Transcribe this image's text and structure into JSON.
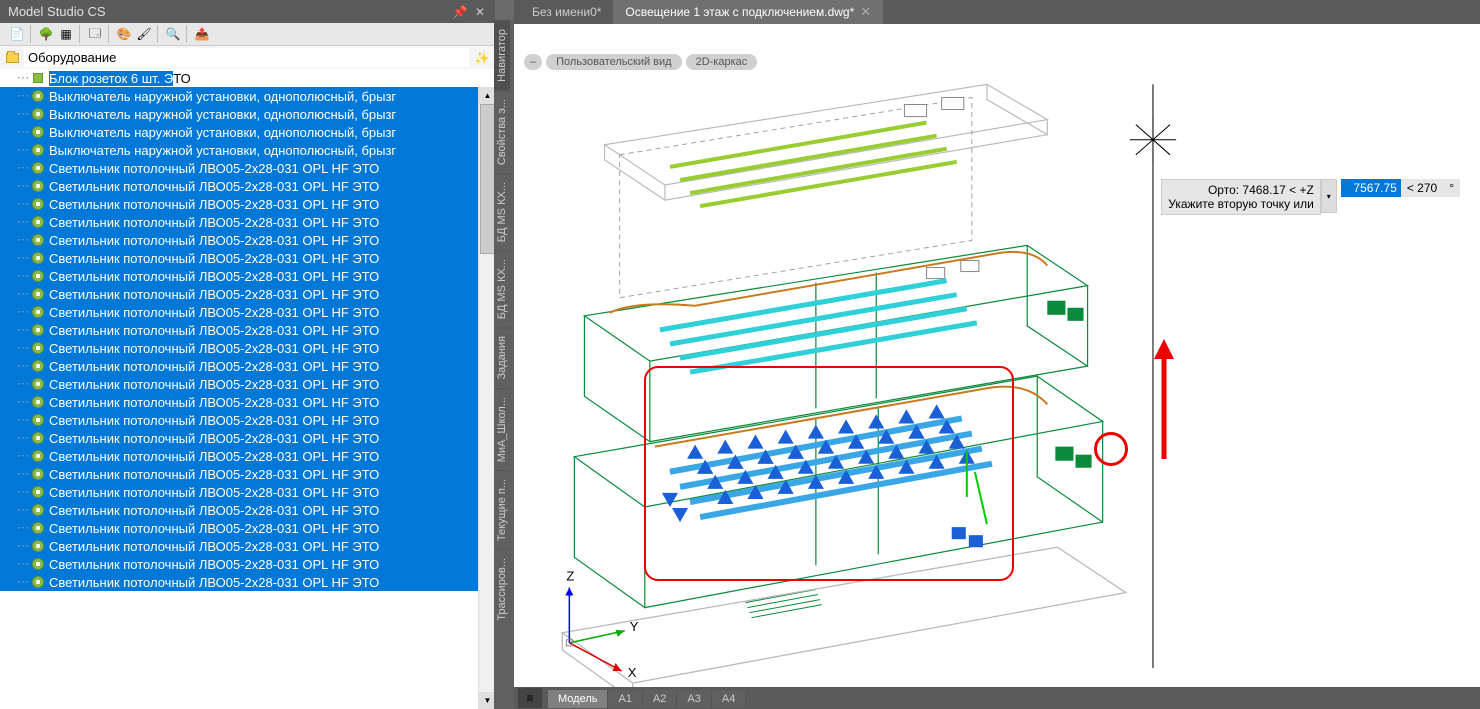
{
  "panel": {
    "title": "Model Studio CS",
    "search_label": "Оборудование",
    "tree": [
      {
        "type": "block",
        "label": "Блок розеток 6 шт.  ЭТО",
        "sel": "part"
      },
      {
        "type": "gear",
        "label": "Выключатель наружной установки, однополюсный, брызг",
        "sel": "full"
      },
      {
        "type": "gear",
        "label": "Выключатель наружной установки, однополюсный, брызг",
        "sel": "full"
      },
      {
        "type": "gear",
        "label": "Выключатель наружной установки, однополюсный, брызг",
        "sel": "full"
      },
      {
        "type": "gear",
        "label": "Выключатель наружной установки, однополюсный, брызг",
        "sel": "full"
      },
      {
        "type": "gear",
        "label": "Светильник потолочный ЛВО05-2х28-031 OPL HF  ЭТО",
        "sel": "full"
      },
      {
        "type": "gear",
        "label": "Светильник потолочный ЛВО05-2х28-031 OPL HF  ЭТО",
        "sel": "full"
      },
      {
        "type": "gear",
        "label": "Светильник потолочный ЛВО05-2х28-031 OPL HF  ЭТО",
        "sel": "full"
      },
      {
        "type": "gear",
        "label": "Светильник потолочный ЛВО05-2х28-031 OPL HF  ЭТО",
        "sel": "full"
      },
      {
        "type": "gear",
        "label": "Светильник потолочный ЛВО05-2х28-031 OPL HF  ЭТО",
        "sel": "full"
      },
      {
        "type": "gear",
        "label": "Светильник потолочный ЛВО05-2х28-031 OPL HF  ЭТО",
        "sel": "full"
      },
      {
        "type": "gear",
        "label": "Светильник потолочный ЛВО05-2х28-031 OPL HF  ЭТО",
        "sel": "full"
      },
      {
        "type": "gear",
        "label": "Светильник потолочный ЛВО05-2х28-031 OPL HF  ЭТО",
        "sel": "full"
      },
      {
        "type": "gear",
        "label": "Светильник потолочный ЛВО05-2х28-031 OPL HF  ЭТО",
        "sel": "full"
      },
      {
        "type": "gear",
        "label": "Светильник потолочный ЛВО05-2х28-031 OPL HF  ЭТО",
        "sel": "full"
      },
      {
        "type": "gear",
        "label": "Светильник потолочный ЛВО05-2х28-031 OPL HF  ЭТО",
        "sel": "full"
      },
      {
        "type": "gear",
        "label": "Светильник потолочный ЛВО05-2х28-031 OPL HF  ЭТО",
        "sel": "full"
      },
      {
        "type": "gear",
        "label": "Светильник потолочный ЛВО05-2х28-031 OPL HF  ЭТО",
        "sel": "full"
      },
      {
        "type": "gear",
        "label": "Светильник потолочный ЛВО05-2х28-031 OPL HF  ЭТО",
        "sel": "full"
      },
      {
        "type": "gear",
        "label": "Светильник потолочный ЛВО05-2х28-031 OPL HF  ЭТО",
        "sel": "full"
      },
      {
        "type": "gear",
        "label": "Светильник потолочный ЛВО05-2х28-031 OPL HF  ЭТО",
        "sel": "full"
      },
      {
        "type": "gear",
        "label": "Светильник потолочный ЛВО05-2х28-031 OPL HF  ЭТО",
        "sel": "full"
      },
      {
        "type": "gear",
        "label": "Светильник потолочный ЛВО05-2х28-031 OPL HF  ЭТО",
        "sel": "full"
      },
      {
        "type": "gear",
        "label": "Светильник потолочный ЛВО05-2х28-031 OPL HF  ЭТО",
        "sel": "full"
      },
      {
        "type": "gear",
        "label": "Светильник потолочный ЛВО05-2х28-031 OPL HF  ЭТО",
        "sel": "full"
      },
      {
        "type": "gear",
        "label": "Светильник потолочный ЛВО05-2х28-031 OPL HF  ЭТО",
        "sel": "full"
      },
      {
        "type": "gear",
        "label": "Светильник потолочный ЛВО05-2х28-031 OPL HF  ЭТО",
        "sel": "full"
      },
      {
        "type": "gear",
        "label": "Светильник потолочный ЛВО05-2х28-031 OPL HF  ЭТО",
        "sel": "full"
      },
      {
        "type": "gear",
        "label": "Светильник потолочный ЛВО05-2х28-031 OPL HF  ЭТО",
        "sel": "full"
      }
    ]
  },
  "side_tabs": [
    "Навигатор",
    "Свойства э...",
    "БД MS КХ...",
    "БД MS КХ...",
    "Задания",
    "МиА_Школ...",
    "Текущие п...",
    "Трассиров..."
  ],
  "doc_tabs": [
    {
      "label": "Без имени0*",
      "active": false
    },
    {
      "label": "Освещение 1 этаж с подключением.dwg*",
      "active": true
    }
  ],
  "canvas_pills": {
    "minus": "–",
    "view": "Пользовательский вид",
    "style": "2D-каркас"
  },
  "coord": {
    "line1": "Орто: 7468.17 <  +Z",
    "line2": "Укажите вторую точку или",
    "value": "7567.75",
    "angle_lt": "<  270",
    "degree": "°"
  },
  "ucs": {
    "z": "Z",
    "y": "Y",
    "x": "X"
  },
  "bottom_tabs": [
    "Модель",
    "A1",
    "A2",
    "A3",
    "A4"
  ]
}
